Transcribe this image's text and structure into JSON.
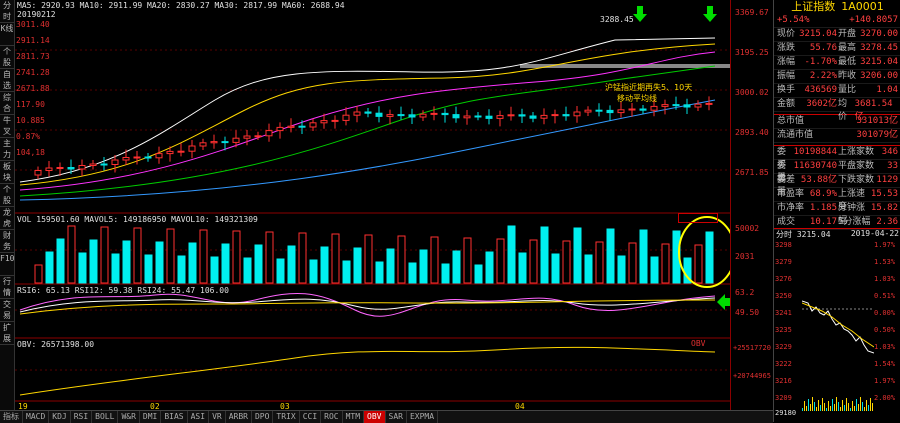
{
  "sidebar": {
    "items": [
      "分时",
      "K线",
      "个股资料",
      "自选股",
      "综合排名",
      "牛叉诊股",
      "主力监控",
      "板块监控",
      "个股研究",
      "龙虎榜",
      "财务",
      "F10",
      "行情",
      "交易",
      "扩展"
    ]
  },
  "main": {
    "price_header": "MA5: 2920.93  MA10: 2911.99  MA20: 2830.27  MA30: 2817.99  MA60: 2688.94",
    "date_label": "20190212",
    "high_price": "3288.45",
    "left_scale": [
      "3011.40",
      "2911.14",
      "2811.73",
      "2741.28",
      "2671.88",
      "117.90",
      "10.885",
      "0.87%",
      "104,18"
    ],
    "annotation_line1": "沪锰指近期再失5、10天",
    "annotation_line2": "移动平均线",
    "vol_header": "VOL 159501.60  MAVOL5: 149186950  MAVOL10: 149321309",
    "rsi_header": "RSI6: 65.13  RSI12: 59.38  RSI24: 55.47  106.00",
    "obv_header": "OBV: 26571398.00",
    "obv_right": "+25517720",
    "obv_right2": "+20744965",
    "x_dates": [
      "19",
      "02",
      "03",
      "04"
    ]
  },
  "axis": {
    "labels": [
      "3369.67",
      "3195.25",
      "3000.02",
      "2893.40",
      "2671.85",
      "50002",
      "2031",
      "63.2",
      "49.50"
    ]
  },
  "panel": {
    "title": "上证指数",
    "code": "1A0001",
    "change_a": "+5.54%",
    "change_b": "+140.8057",
    "quotes": [
      {
        "k": "现价",
        "v": "3215.04",
        "k2": "开盘",
        "v2": "3270.00"
      },
      {
        "k": "涨跌",
        "v": "55.76",
        "k2": "最高",
        "v2": "3278.45"
      },
      {
        "k": "涨幅",
        "v": "-1.70%",
        "k2": "最低",
        "v2": "3215.04"
      },
      {
        "k": "振幅",
        "v": "2.22%",
        "k2": "昨收",
        "v2": "3206.00"
      },
      {
        "k": "换手",
        "v": "436569",
        "k2": "量比",
        "v2": "1.04"
      },
      {
        "k": "金额",
        "v": "3602亿",
        "k2": "均价",
        "v2": "3681.54亿"
      }
    ],
    "assets": [
      {
        "k": "总市值",
        "v": "331013亿"
      },
      {
        "k": "流通市值",
        "v": "301079亿"
      }
    ],
    "stats": [
      {
        "k": "委买量",
        "v": "10198844",
        "k2": "上涨家数",
        "v2": "346"
      },
      {
        "k": "委卖量",
        "v": "11630740",
        "k2": "平盘家数",
        "v2": "33"
      },
      {
        "k": "委差",
        "v": "53.88亿",
        "k2": "下跌家数",
        "v2": "1129"
      },
      {
        "k": "市盈率",
        "v": "68.9%",
        "k2": "上涨速度",
        "v2": "15.53"
      },
      {
        "k": "市净率",
        "v": "1.185",
        "k2": "分钟涨幅",
        "v2": "15.82"
      },
      {
        "k": "成交",
        "v": "10.17",
        "k2": "5分涨幅",
        "v2": "2.36"
      }
    ],
    "mini_header_left": "分时 3215.04",
    "mini_header_right": "2019-04-22",
    "mini_left_scale": [
      "3298",
      "3279",
      "3276",
      "3250",
      "3241",
      "3235",
      "3229",
      "3222",
      "3216",
      "3209"
    ],
    "mini_right_scale": [
      "1.97%",
      "1.53%",
      "1.03%",
      "0.51%",
      "0.00%",
      "0.50%",
      "1.03%",
      "1.54%",
      "1.97%",
      "2.00%"
    ],
    "mini_volume": "29180"
  },
  "tabs": [
    "指标",
    "MACD",
    "KDJ",
    "RSI",
    "BOLL",
    "W&R",
    "DMI",
    "BIAS",
    "ASI",
    "VR",
    "ARBR",
    "DPO",
    "TRIX",
    "CCI",
    "ROC",
    "MTM",
    "OBV",
    "SAR",
    "EXPMA"
  ],
  "active_tab": "OBV"
}
